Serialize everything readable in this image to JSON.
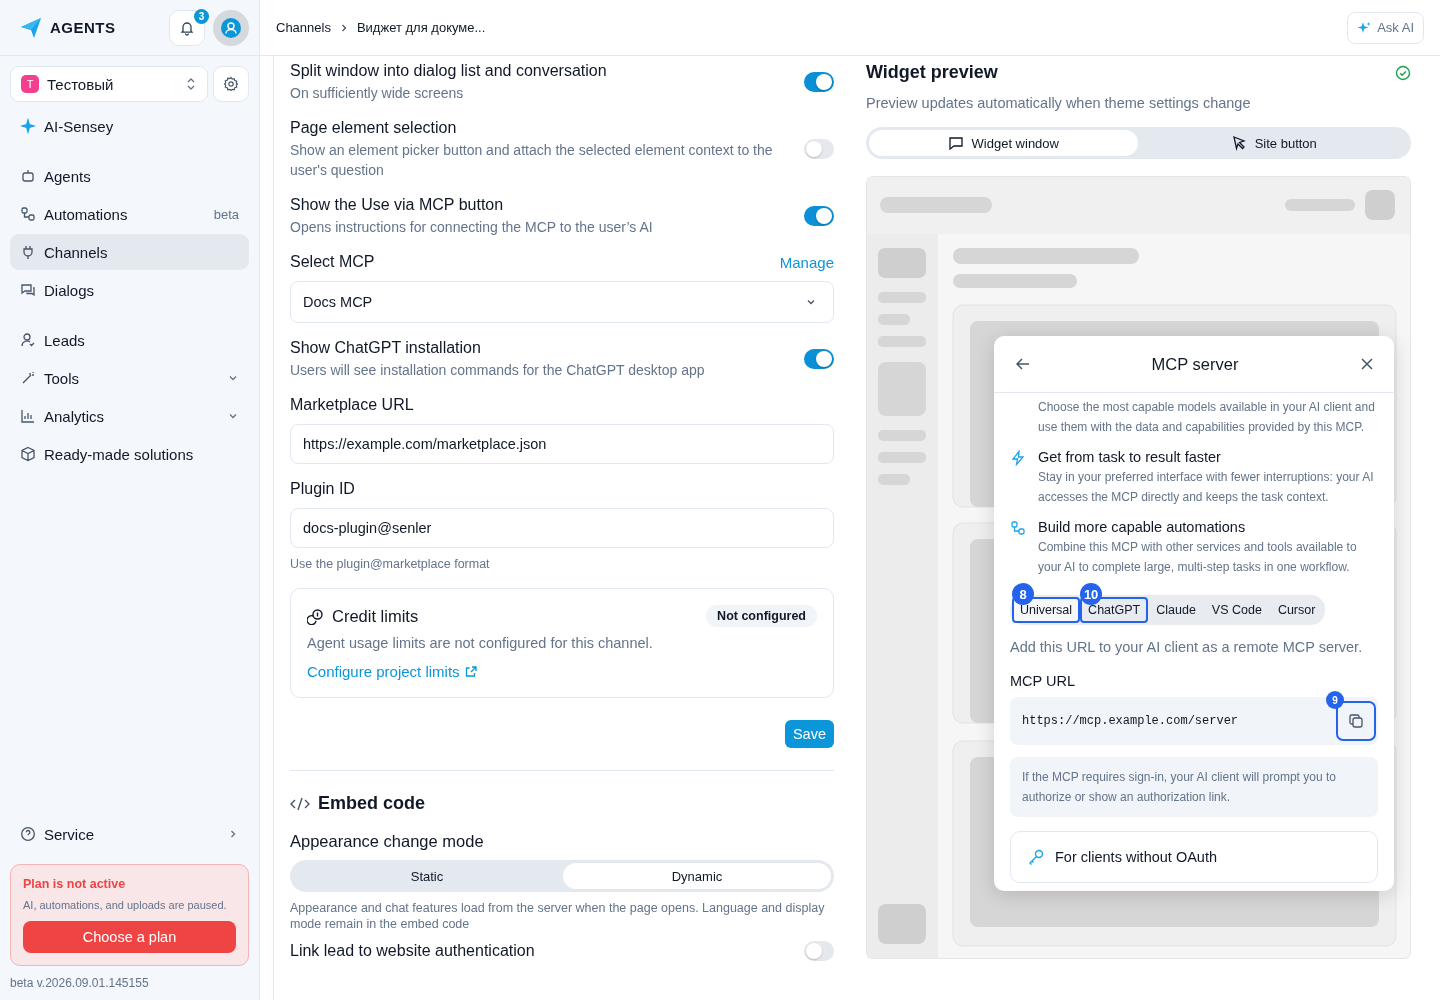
{
  "sidebar": {
    "brand": "AGENTS",
    "notification_count": "3",
    "project": {
      "initial": "T",
      "name": "Тестовый"
    },
    "sections": [
      [
        {
          "label": "AI-Sensey",
          "kind": "link",
          "selected": false
        }
      ],
      [
        {
          "label": "Agents",
          "kind": "link",
          "selected": false
        },
        {
          "label": "Automations",
          "kind": "link",
          "selected": false,
          "badge": "beta"
        },
        {
          "label": "Channels",
          "kind": "link",
          "selected": true
        },
        {
          "label": "Dialogs",
          "kind": "link",
          "selected": false
        }
      ],
      [
        {
          "label": "Leads",
          "kind": "link",
          "selected": false
        },
        {
          "label": "Tools",
          "kind": "group",
          "selected": false
        },
        {
          "label": "Analytics",
          "kind": "group",
          "selected": false
        },
        {
          "label": "Ready-made solutions",
          "kind": "link",
          "selected": false
        }
      ]
    ],
    "service": "Service",
    "plan_alert": {
      "title": "Plan is not active",
      "text": "AI, automations, and uploads are paused.",
      "button": "Choose a plan"
    },
    "version": "beta v.2026.09.01.145155"
  },
  "header": {
    "breadcrumbs": [
      "Channels",
      "Виджет для докуме..."
    ],
    "ask_ai": "Ask AI"
  },
  "settings": {
    "rows": [
      {
        "kind": "toggle",
        "title": "Split window into dialog list and conversation",
        "description": "On sufficiently wide screens",
        "on": true
      },
      {
        "kind": "toggle",
        "title": "Page element selection",
        "description": "Show an element picker button and attach the selected element context to the user's question",
        "on": false
      },
      {
        "kind": "toggle",
        "title": "Show the Use via MCP button",
        "description": "Opens instructions for connecting the MCP to the user’s AI",
        "on": true
      },
      {
        "kind": "select",
        "title": "Select MCP",
        "action": "Manage",
        "value": "Docs MCP"
      },
      {
        "kind": "toggle",
        "title": "Show ChatGPT installation",
        "description": "Users will see installation commands for the ChatGPT desktop app",
        "on": true
      },
      {
        "kind": "field",
        "title": "Marketplace URL",
        "value": "https://example.com/marketplace.json"
      },
      {
        "kind": "field",
        "title": "Plugin ID",
        "value": "docs-plugin@senler",
        "hint": "Use the plugin@marketplace format"
      }
    ],
    "credit_limits": {
      "title": "Credit limits",
      "status": "Not configured",
      "description": "Agent usage limits are not configured for this channel.",
      "link": "Configure project limits"
    },
    "save": "Save",
    "embed": {
      "title": "Embed code",
      "mode_label": "Appearance change mode",
      "modes": [
        {
          "label": "Static",
          "selected": false
        },
        {
          "label": "Dynamic",
          "selected": true
        }
      ],
      "note": "Appearance and chat features load from the server when the page opens. Language and display mode remain in the embed code",
      "next_toggle": {
        "title": "Link lead to website authentication",
        "on": false
      }
    }
  },
  "preview": {
    "title": "Widget preview",
    "subtitle": "Preview updates automatically when theme settings change",
    "tabs": [
      {
        "label": "Widget window",
        "selected": true
      },
      {
        "label": "Site button",
        "selected": false
      }
    ],
    "modal": {
      "title": "MCP server",
      "intro": "Choose the most capable models available in your AI client and use them with the data and capabilities provided by this MCP.",
      "features": [
        {
          "title": "Get from task to result faster",
          "description": "Stay in your preferred interface with fewer interruptions: your AI accesses the MCP directly and keeps the task context."
        },
        {
          "title": "Build more capable automations",
          "description": "Combine this MCP with other services and tools available to your AI to complete large, multi-step tasks in one workflow."
        }
      ],
      "client_tabs": [
        {
          "label": "Universal",
          "selected": true,
          "marker": "8"
        },
        {
          "label": "ChatGPT",
          "selected": false,
          "marker": "10"
        },
        {
          "label": "Claude",
          "selected": false
        },
        {
          "label": "VS Code",
          "selected": false
        },
        {
          "label": "Cursor",
          "selected": false
        }
      ],
      "instruction": "Add this URL to your AI client as a remote MCP server.",
      "url_label": "MCP URL",
      "url": "https://mcp.example.com/server",
      "copy_marker": "9",
      "note": "If the MCP requires sign-in, your AI client will prompt you to authorize or show an authorization link.",
      "oauth_title": "For clients without OAuth"
    }
  }
}
